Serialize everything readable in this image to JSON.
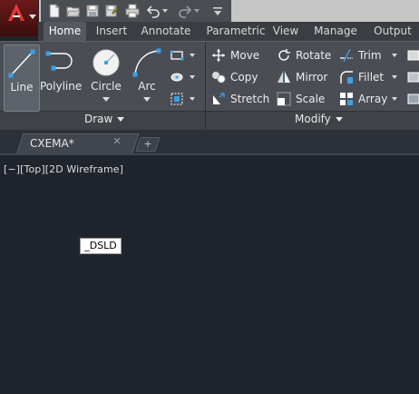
{
  "tabs": [
    "Home",
    "Insert",
    "Annotate",
    "Parametric",
    "View",
    "Manage",
    "Output"
  ],
  "active_tab": "Home",
  "draw_panel": {
    "title": "Draw",
    "tools": [
      {
        "label": "Line"
      },
      {
        "label": "Polyline"
      },
      {
        "label": "Circle"
      },
      {
        "label": "Arc"
      }
    ]
  },
  "modify_panel": {
    "title": "Modify",
    "items": [
      {
        "label": "Move",
        "icon": "move-icon"
      },
      {
        "label": "Rotate",
        "icon": "rotate-icon"
      },
      {
        "label": "Trim",
        "icon": "trim-icon"
      },
      {
        "label": "Copy",
        "icon": "copy-icon"
      },
      {
        "label": "Mirror",
        "icon": "mirror-icon"
      },
      {
        "label": "Fillet",
        "icon": "fillet-icon"
      },
      {
        "label": "Stretch",
        "icon": "stretch-icon"
      },
      {
        "label": "Scale",
        "icon": "scale-icon"
      },
      {
        "label": "Array",
        "icon": "array-icon"
      }
    ]
  },
  "document_tab": {
    "label": "CXEMA*",
    "close": "✕"
  },
  "new_tab_symbol": "+",
  "viewport_label": "[−][Top][2D Wireframe]",
  "command_tooltip": "_DSLD",
  "colors": {
    "app_button": "#6b1b1b",
    "ribbon": "#4a4e54",
    "canvas": "#1f242d",
    "accent": "#3aa0e8"
  }
}
